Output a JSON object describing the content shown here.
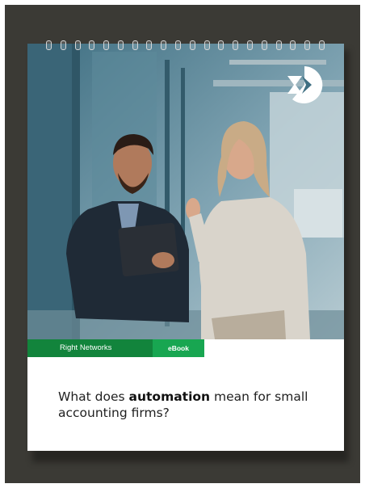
{
  "brand": {
    "name": "Right Networks",
    "tag": "eBook"
  },
  "heading": {
    "prefix": "What does ",
    "emphasis": "automation",
    "suffix": " mean for small accounting firms?"
  },
  "colors": {
    "background_frame": "#3b3a35",
    "brand_green": "#12843c",
    "tag_green": "#18a651",
    "title_text": "#1f1f1f"
  },
  "icons": {
    "logo": "arrow-chevron-logo-icon",
    "binding": "spiral-binding-rings"
  }
}
